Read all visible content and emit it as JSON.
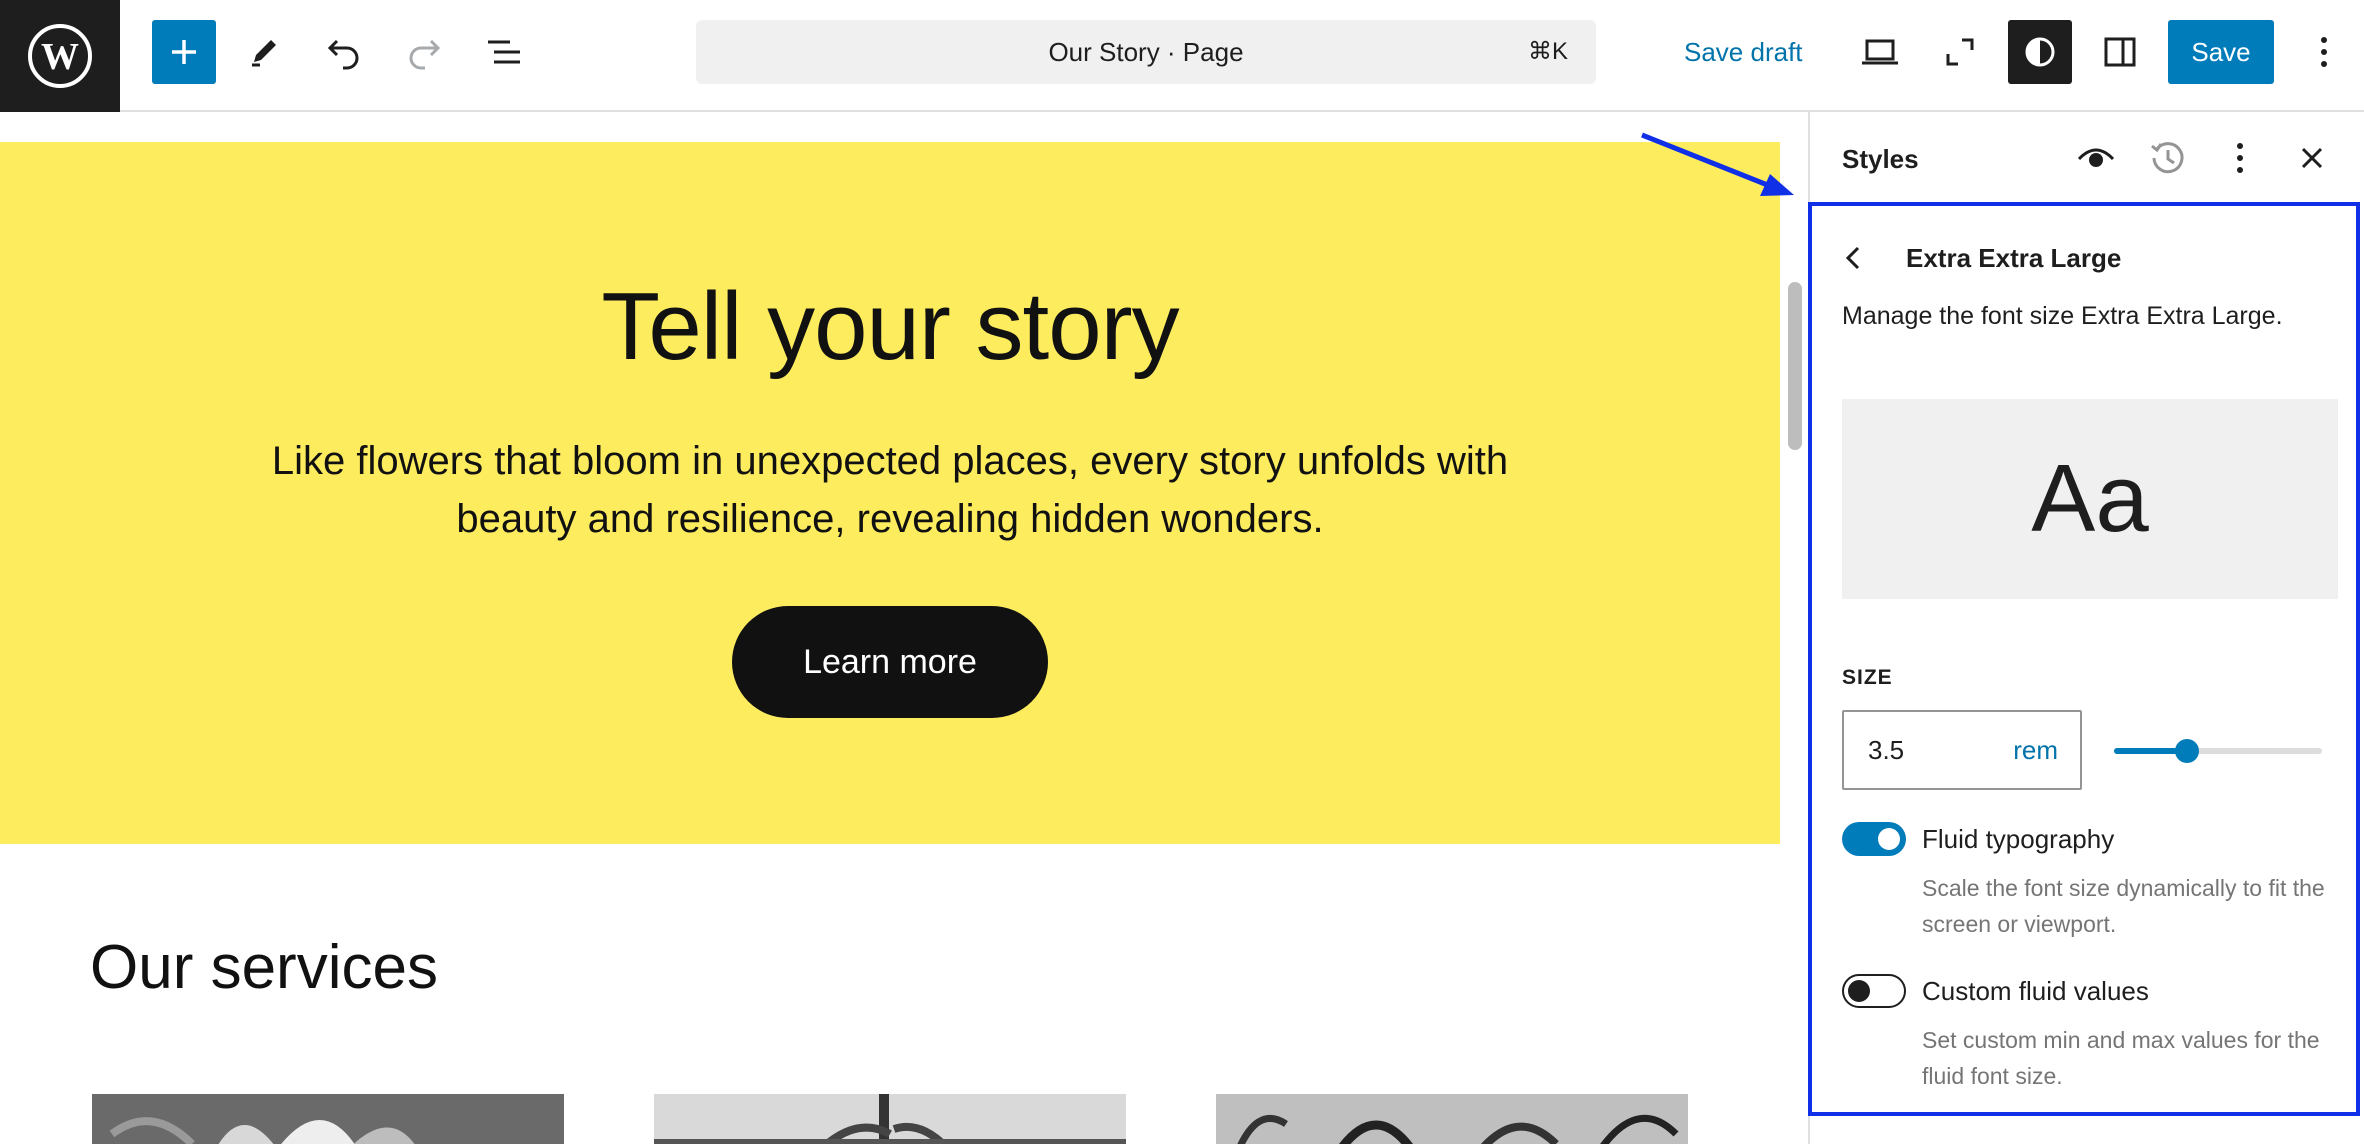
{
  "topbar": {
    "document_title": "Our Story · Page",
    "shortcut": "⌘K",
    "save_draft": "Save draft",
    "save": "Save"
  },
  "canvas": {
    "hero_title": "Tell your story",
    "hero_text": "Like flowers that bloom in unexpected places, every story unfolds with beauty and resilience, revealing hidden wonders.",
    "hero_button": "Learn more",
    "hero_bg": "#fdec5e",
    "services_heading": "Our services"
  },
  "panel": {
    "title": "Styles",
    "subpage_title": "Extra Extra Large",
    "description": "Manage the font size Extra Extra Large.",
    "preview_text": "Aa",
    "size_label": "SIZE",
    "size_value": "3.5",
    "size_unit": "rem",
    "slider_fraction": 0.35,
    "fluid_label": "Fluid typography",
    "fluid_help": "Scale the font size dynamically to fit the screen or viewport.",
    "fluid_on": true,
    "custom_label": "Custom fluid values",
    "custom_help": "Set custom min and max values for the fluid font size.",
    "custom_on": false,
    "accent_color": "#007cba",
    "highlight_color": "#1030e8"
  }
}
